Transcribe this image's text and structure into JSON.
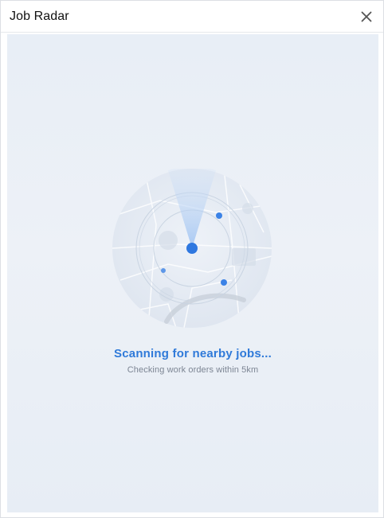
{
  "window": {
    "title": "Job Radar"
  },
  "icons": {
    "close": "close-icon"
  },
  "status": {
    "title": "Scanning for nearby jobs...",
    "subtitle": "Checking work orders within 5km"
  },
  "colors": {
    "accent": "#2f7ad9",
    "radar_dot": "#3b82e6",
    "background": "#e9eff6"
  }
}
